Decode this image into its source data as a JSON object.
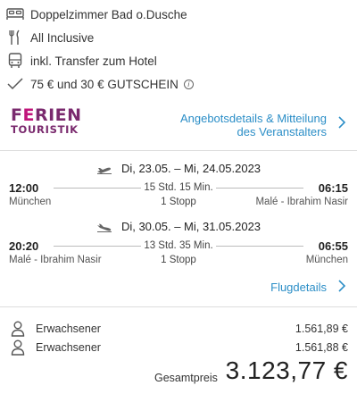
{
  "features": [
    {
      "icon": "bed-icon",
      "text": "Doppelzimmer Bad o.Dusche"
    },
    {
      "icon": "fork-knife-icon",
      "text": "All Inclusive"
    },
    {
      "icon": "bus-icon",
      "text": "inkl. Transfer zum Hotel"
    },
    {
      "icon": "checkmark-icon",
      "text": "75 € und 30 € GUTSCHEIN"
    }
  ],
  "operator": {
    "logo_top_pre": "F",
    "logo_top_e": "E",
    "logo_top_post": "RIEN",
    "logo_bottom": "TOURISTIK",
    "details_line1": "Angebotsdetails & Mitteilung",
    "details_line2": "des Veranstalters"
  },
  "outbound": {
    "dates": "Di, 23.05. – Mi, 24.05.2023",
    "dep_time": "12:00",
    "dep_city": "München",
    "duration": "15 Std. 15 Min.",
    "stops": "1 Stopp",
    "arr_time": "06:15",
    "arr_city": "Malé - Ibrahim Nasir"
  },
  "return": {
    "dates": "Di, 30.05. – Mi, 31.05.2023",
    "dep_time": "20:20",
    "dep_city": "Malé - Ibrahim Nasir",
    "duration": "13 Std. 35 Min.",
    "stops": "1 Stopp",
    "arr_time": "06:55",
    "arr_city": "München"
  },
  "flight_details_label": "Flugdetails",
  "passengers": [
    {
      "label": "Erwachsener",
      "amount": "1.561,89 €"
    },
    {
      "label": "Erwachsener",
      "amount": "1.561,88 €"
    }
  ],
  "total": {
    "label": "Gesamtpreis",
    "amount": "3.123,77 €"
  },
  "colors": {
    "link": "#2b8ec7",
    "logo_purple": "#7a2a6e",
    "logo_magenta": "#c0147a"
  }
}
